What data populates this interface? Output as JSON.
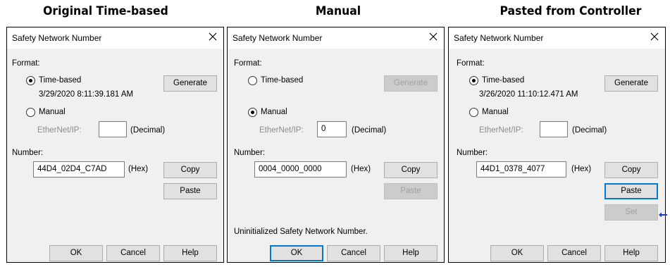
{
  "captions": [
    "Original Time-based",
    "Manual",
    "Pasted from Controller"
  ],
  "dialogs": [
    {
      "title": "Safety Network Number",
      "format_label": "Format:",
      "time_based_label": "Time-based",
      "time_based_checked": true,
      "timestamp": "3/29/2020 8:11:39.181 AM",
      "generate_label": "Generate",
      "generate_enabled": true,
      "manual_label": "Manual",
      "manual_checked": false,
      "ethernet_label": "EtherNet/IP:",
      "ethernet_value": "",
      "decimal_label": "(Decimal)",
      "number_label": "Number:",
      "number_value": "44D4_02D4_C7AD",
      "hex_label": "(Hex)",
      "copy_label": "Copy",
      "paste_label": "Paste",
      "paste_enabled": true,
      "status_text": "",
      "ok_label": "OK",
      "cancel_label": "Cancel",
      "help_label": "Help"
    },
    {
      "title": "Safety Network Number",
      "format_label": "Format:",
      "time_based_label": "Time-based",
      "time_based_checked": false,
      "timestamp": "",
      "generate_label": "Generate",
      "generate_enabled": false,
      "manual_label": "Manual",
      "manual_checked": true,
      "ethernet_label": "EtherNet/IP:",
      "ethernet_value": "0",
      "decimal_label": "(Decimal)",
      "number_label": "Number:",
      "number_value": "0004_0000_0000",
      "hex_label": "(Hex)",
      "copy_label": "Copy",
      "paste_label": "Paste",
      "paste_enabled": false,
      "status_text": "Uninitialized Safety Network Number.",
      "ok_label": "OK",
      "cancel_label": "Cancel",
      "help_label": "Help"
    },
    {
      "title": "Safety Network Number",
      "format_label": "Format:",
      "time_based_label": "Time-based",
      "time_based_checked": true,
      "timestamp": "3/26/2020 11:10:12.471 AM",
      "generate_label": "Generate",
      "generate_enabled": true,
      "manual_label": "Manual",
      "manual_checked": false,
      "ethernet_label": "EtherNet/IP:",
      "ethernet_value": "",
      "decimal_label": "(Decimal)",
      "number_label": "Number:",
      "number_value": "44D1_0378_4077",
      "hex_label": "(Hex)",
      "copy_label": "Copy",
      "paste_label": "Paste",
      "paste_enabled": true,
      "set_label": "Set",
      "set_enabled": false,
      "status_text": "",
      "ok_label": "OK",
      "cancel_label": "Cancel",
      "help_label": "Help"
    }
  ],
  "colors": {
    "dialog_bg": "#f0f0f0",
    "focus_blue": "#0078d7",
    "arrow_blue": "#1f3fbf"
  },
  "icons": {
    "close": "close-icon",
    "pointer": "left-arrow-icon"
  }
}
